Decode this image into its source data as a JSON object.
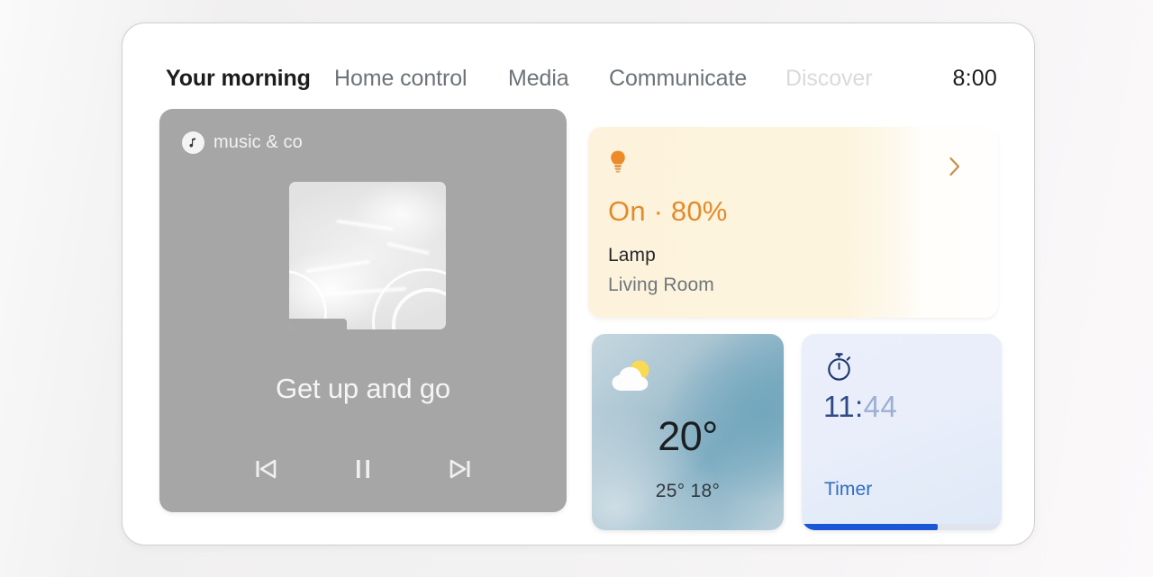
{
  "device": {
    "name": "smart-display"
  },
  "nav": {
    "items": [
      {
        "id": "your-morning",
        "label": "Your morning",
        "state": "active"
      },
      {
        "id": "home-control",
        "label": "Home control",
        "state": "normal"
      },
      {
        "id": "media",
        "label": "Media",
        "state": "normal"
      },
      {
        "id": "communicate",
        "label": "Communicate",
        "state": "normal"
      },
      {
        "id": "discover",
        "label": "Discover",
        "state": "faded"
      }
    ],
    "clock": "8:00"
  },
  "music_card": {
    "brand": "music & co",
    "brand_icon": "music-note-icon",
    "album_art_alt": "abstract-album-art",
    "track_title": "Get up and go",
    "controls": [
      {
        "id": "previous",
        "label": "Previous track",
        "icon": "skip-previous-icon"
      },
      {
        "id": "pause",
        "label": "Pause",
        "icon": "pause-icon"
      },
      {
        "id": "next",
        "label": "Next track",
        "icon": "skip-next-icon"
      }
    ],
    "background_color": "#a6a6a6"
  },
  "lamp_card": {
    "icon": "lightbulb-icon",
    "state": "On · 80%",
    "name": "Lamp",
    "room": "Living Room",
    "chevron": "chevron-right-icon",
    "accent_color": "#e28b2c",
    "background_color": "#fdf3dc"
  },
  "weather_card": {
    "icon": "partly-cloudy-icon",
    "temperature": "20°",
    "range": "25° 18°",
    "high": "25°",
    "low": "18°",
    "background_color": "#7fadc2"
  },
  "timer_card": {
    "icon": "stopwatch-icon",
    "time_elapsed": "11:",
    "time_remaining": "44",
    "time_full": "11:44",
    "label": "Timer",
    "progress_percent": 68,
    "accent_color": "#1a56d6",
    "background_color": "#eaeffb"
  }
}
